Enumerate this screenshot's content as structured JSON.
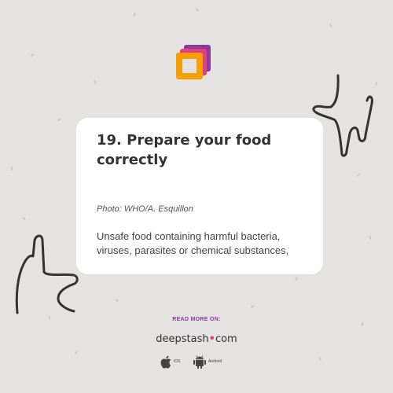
{
  "card": {
    "title": "19. Prepare your food correctly",
    "photo_credit": "Photo: WHO/A. Esquillon",
    "body": "Unsafe food containing harmful bacteria, viruses, parasites or chemical substances,"
  },
  "footer": {
    "read_more": "READ MORE ON:",
    "brand_name": "deepstash",
    "brand_dot": "•",
    "brand_tld": "com",
    "ios_label": "iOS",
    "android_label": "Android"
  },
  "icons": {
    "logo": "deepstash-logo-icon",
    "apple": "apple-icon",
    "android": "android-icon",
    "hand_right": "hand-drawing-icon",
    "hand_left": "hand-drawing-icon"
  },
  "colors": {
    "background": "#e5e3e1",
    "card": "#ffffff",
    "accent": "#8a3a97",
    "logo_orange": "#f5a000",
    "logo_purple": "#8a3a97",
    "logo_pink": "#e0407f"
  }
}
